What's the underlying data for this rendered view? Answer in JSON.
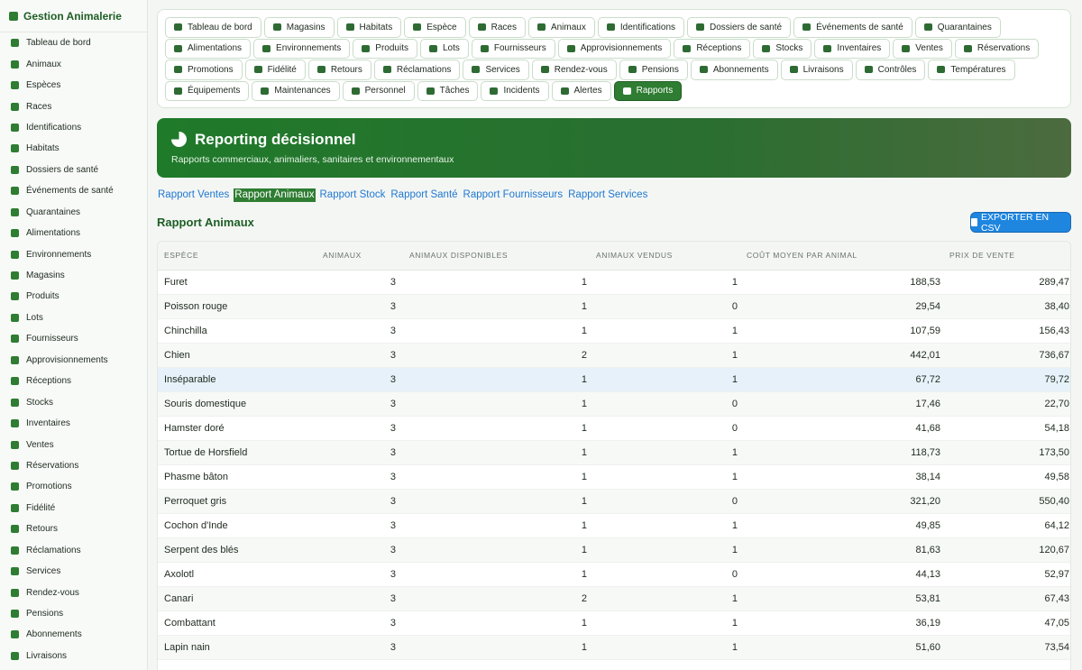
{
  "brand": {
    "title": "Gestion Animalerie"
  },
  "sidebar": {
    "items": [
      {
        "label": "Tableau de bord"
      },
      {
        "label": "Animaux"
      },
      {
        "label": "Espèces"
      },
      {
        "label": "Races"
      },
      {
        "label": "Identifications"
      },
      {
        "label": "Habitats"
      },
      {
        "label": "Dossiers de santé"
      },
      {
        "label": "Événements de santé"
      },
      {
        "label": "Quarantaines"
      },
      {
        "label": "Alimentations"
      },
      {
        "label": "Environnements"
      },
      {
        "label": "Magasins"
      },
      {
        "label": "Produits"
      },
      {
        "label": "Lots"
      },
      {
        "label": "Fournisseurs"
      },
      {
        "label": "Approvisionnements"
      },
      {
        "label": "Réceptions"
      },
      {
        "label": "Stocks"
      },
      {
        "label": "Inventaires"
      },
      {
        "label": "Ventes"
      },
      {
        "label": "Réservations"
      },
      {
        "label": "Promotions"
      },
      {
        "label": "Fidélité"
      },
      {
        "label": "Retours"
      },
      {
        "label": "Réclamations"
      },
      {
        "label": "Services"
      },
      {
        "label": "Rendez-vous"
      },
      {
        "label": "Pensions"
      },
      {
        "label": "Abonnements"
      },
      {
        "label": "Livraisons"
      }
    ]
  },
  "topnav": {
    "items": [
      {
        "label": "Tableau de bord"
      },
      {
        "label": "Magasins"
      },
      {
        "label": "Habitats"
      },
      {
        "label": "Espèce"
      },
      {
        "label": "Races"
      },
      {
        "label": "Animaux"
      },
      {
        "label": "Identifications"
      },
      {
        "label": "Dossiers de santé"
      },
      {
        "label": "Événements de santé"
      },
      {
        "label": "Quarantaines"
      },
      {
        "label": "Alimentations"
      },
      {
        "label": "Environnements"
      },
      {
        "label": "Produits"
      },
      {
        "label": "Lots"
      },
      {
        "label": "Fournisseurs"
      },
      {
        "label": "Approvisionnements"
      },
      {
        "label": "Réceptions"
      },
      {
        "label": "Stocks"
      },
      {
        "label": "Inventaires"
      },
      {
        "label": "Ventes"
      },
      {
        "label": "Réservations"
      },
      {
        "label": "Promotions"
      },
      {
        "label": "Fidélité"
      },
      {
        "label": "Retours"
      },
      {
        "label": "Réclamations"
      },
      {
        "label": "Services"
      },
      {
        "label": "Rendez-vous"
      },
      {
        "label": "Pensions"
      },
      {
        "label": "Abonnements"
      },
      {
        "label": "Livraisons"
      },
      {
        "label": "Contrôles"
      },
      {
        "label": "Températures"
      },
      {
        "label": "Équipements"
      },
      {
        "label": "Maintenances"
      },
      {
        "label": "Personnel"
      },
      {
        "label": "Tâches"
      },
      {
        "label": "Incidents"
      },
      {
        "label": "Alertes"
      },
      {
        "label": "Rapports",
        "active": true
      }
    ]
  },
  "banner": {
    "title": "Reporting décisionnel",
    "subtitle": "Rapports commerciaux, animaliers, sanitaires et environnementaux"
  },
  "tabs": {
    "items": [
      {
        "label": "Rapport Ventes"
      },
      {
        "label": "Rapport Animaux",
        "active": true
      },
      {
        "label": "Rapport Stock"
      },
      {
        "label": "Rapport Santé"
      },
      {
        "label": "Rapport Fournisseurs"
      },
      {
        "label": "Rapport Services"
      }
    ]
  },
  "report": {
    "title": "Rapport Animaux",
    "export_label": "EXPORTER EN CSV",
    "columns": [
      "ESPÈCE",
      "ANIMAUX",
      "ANIMAUX DISPONIBLES",
      "ANIMAUX VENDUS",
      "COÛT MOYEN PAR ANIMAL",
      "PRIX DE VENTE"
    ],
    "rows": [
      [
        "Furet",
        "3",
        "1",
        "1",
        "188,53",
        "289,47"
      ],
      [
        "Poisson rouge",
        "3",
        "1",
        "0",
        "29,54",
        "38,40"
      ],
      [
        "Chinchilla",
        "3",
        "1",
        "1",
        "107,59",
        "156,43"
      ],
      [
        "Chien",
        "3",
        "2",
        "1",
        "442,01",
        "736,67"
      ],
      [
        "Inséparable",
        "3",
        "1",
        "1",
        "67,72",
        "79,72"
      ],
      [
        "Souris domestique",
        "3",
        "1",
        "0",
        "17,46",
        "22,70"
      ],
      [
        "Hamster doré",
        "3",
        "1",
        "0",
        "41,68",
        "54,18"
      ],
      [
        "Tortue de Horsfield",
        "3",
        "1",
        "1",
        "118,73",
        "173,50"
      ],
      [
        "Phasme bâton",
        "3",
        "1",
        "1",
        "38,14",
        "49,58"
      ],
      [
        "Perroquet gris",
        "3",
        "1",
        "0",
        "321,20",
        "550,40"
      ],
      [
        "Cochon d'Inde",
        "3",
        "1",
        "1",
        "49,85",
        "64,12"
      ],
      [
        "Serpent des blés",
        "3",
        "1",
        "1",
        "81,63",
        "120,67"
      ],
      [
        "Axolotl",
        "3",
        "1",
        "0",
        "44,13",
        "52,97"
      ],
      [
        "Canari",
        "3",
        "2",
        "1",
        "53,81",
        "67,43"
      ],
      [
        "Combattant",
        "3",
        "1",
        "1",
        "36,19",
        "47,05"
      ],
      [
        "Lapin nain",
        "3",
        "1",
        "1",
        "51,60",
        "73,54"
      ]
    ],
    "highlight_row": 4
  }
}
